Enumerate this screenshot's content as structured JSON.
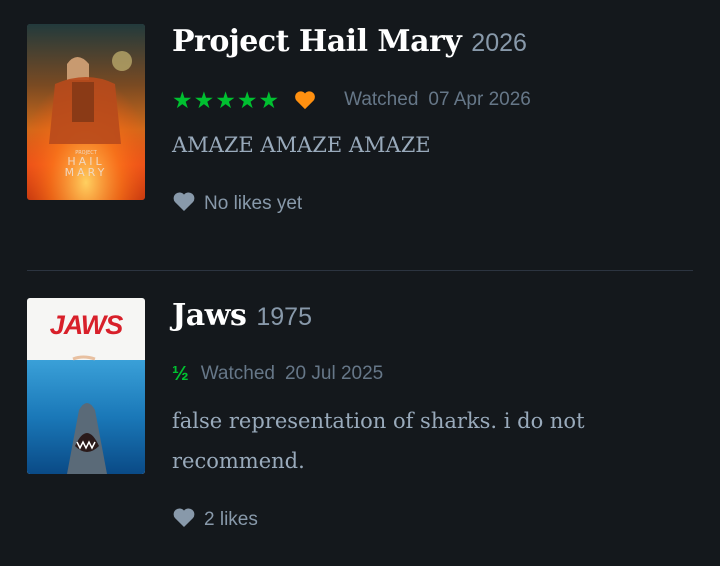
{
  "reviews": [
    {
      "title": "Project Hail Mary",
      "year": "2026",
      "rating_display": "★★★★★",
      "liked": true,
      "watched_label": "Watched",
      "watched_date": "07 Apr 2026",
      "body": "AMAZE AMAZE AMAZE",
      "likes_text": "No likes yet",
      "poster": {
        "small_text": "PROJECT",
        "line1": "HAIL",
        "line2": "MARY"
      }
    },
    {
      "title": "Jaws",
      "year": "1975",
      "rating_display": "½",
      "liked": false,
      "watched_label": "Watched",
      "watched_date": "20 Jul 2025",
      "body": "false representation of sharks. i do not recommend.",
      "likes_text": "2 likes",
      "poster": {
        "title": "JAWS"
      }
    }
  ],
  "colors": {
    "background": "#14181c",
    "star_green": "#00c030",
    "liked_orange": "#ff9010",
    "heart_grey": "#8899aa"
  }
}
